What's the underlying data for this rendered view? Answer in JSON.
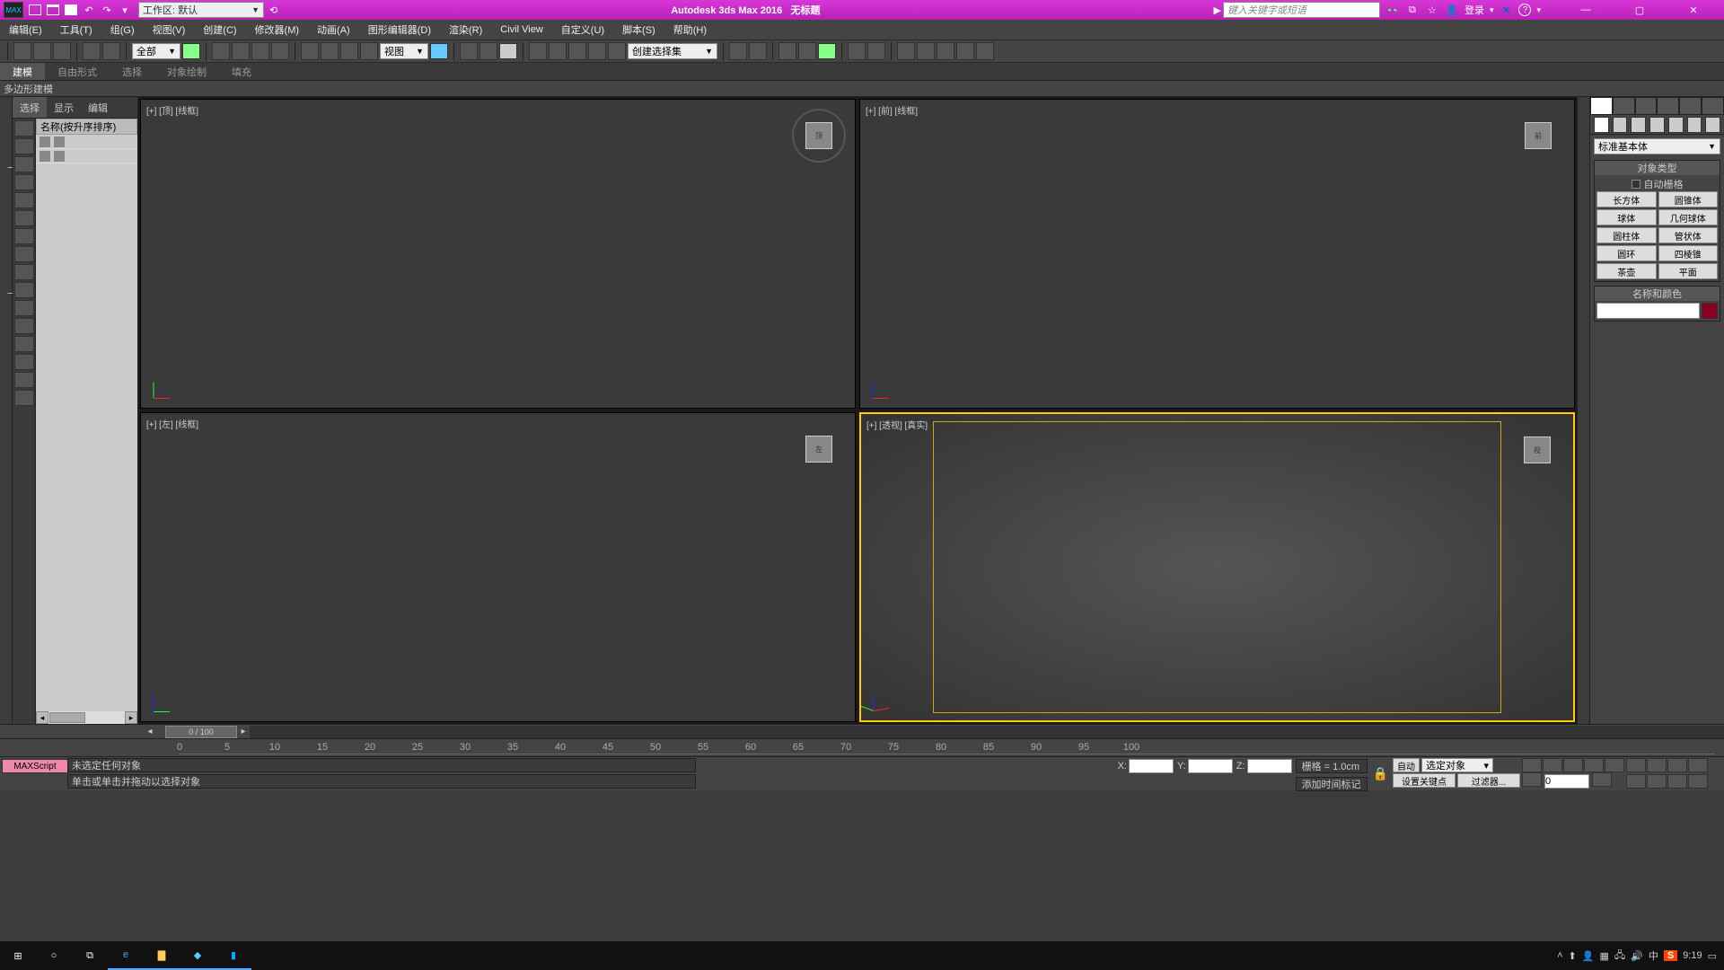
{
  "title": {
    "app": "Autodesk 3ds Max 2016",
    "doc": "无标题",
    "logo": "MAX"
  },
  "workspace": {
    "label": "工作区: 默认"
  },
  "search": {
    "placeholder": "键入关键字或短语"
  },
  "login": "登录",
  "menu": [
    "编辑(E)",
    "工具(T)",
    "组(G)",
    "视图(V)",
    "创建(C)",
    "修改器(M)",
    "动画(A)",
    "图形编辑器(D)",
    "渲染(R)",
    "Civil View",
    "自定义(U)",
    "脚本(S)",
    "帮助(H)"
  ],
  "toolbar": {
    "drop1": "全部",
    "drop2": "视图",
    "drop3": "创建选择集"
  },
  "ribbon": {
    "tabs": [
      "建模",
      "自由形式",
      "选择",
      "对象绘制",
      "填充"
    ],
    "sub": "多边形建模"
  },
  "scene": {
    "tabs": [
      "选择",
      "显示",
      "编辑"
    ],
    "header": "名称(按升序排序)"
  },
  "viewports": {
    "tl": "[+] [顶] [线框]",
    "tr": "[+] [前] [线框]",
    "bl": "[+] [左] [线框]",
    "br": "[+] [透视] [真实]",
    "cube_tl": "顶",
    "cube_tr": "前",
    "cube_bl": "左",
    "cube_br": "视"
  },
  "cmd": {
    "category": "标准基本体",
    "roll_type": "对象类型",
    "autogrid": "自动栅格",
    "prims": [
      "长方体",
      "圆锥体",
      "球体",
      "几何球体",
      "圆柱体",
      "管状体",
      "圆环",
      "四棱锥",
      "茶壶",
      "平面"
    ],
    "roll_name": "名称和颜色"
  },
  "time": {
    "slider": "0 / 100",
    "ticks": [
      0,
      5,
      10,
      15,
      20,
      25,
      30,
      35,
      40,
      45,
      50,
      55,
      60,
      65,
      70,
      75,
      80,
      85,
      90,
      95,
      100
    ]
  },
  "status": {
    "maxscript": "MAXScript",
    "msg1": "未选定任何对象",
    "msg2": "单击或单击并拖动以选择对象",
    "x": "X:",
    "y": "Y:",
    "z": "Z:",
    "grid": "栅格 = 1.0cm",
    "auto": "自动",
    "selobj": "选定对象",
    "addtime": "添加时间标记",
    "setkey": "设置关键点",
    "filter": "过滤器...",
    "frame": "0"
  },
  "taskbar": {
    "im": "中",
    "sog": "S",
    "time": "9:19"
  }
}
